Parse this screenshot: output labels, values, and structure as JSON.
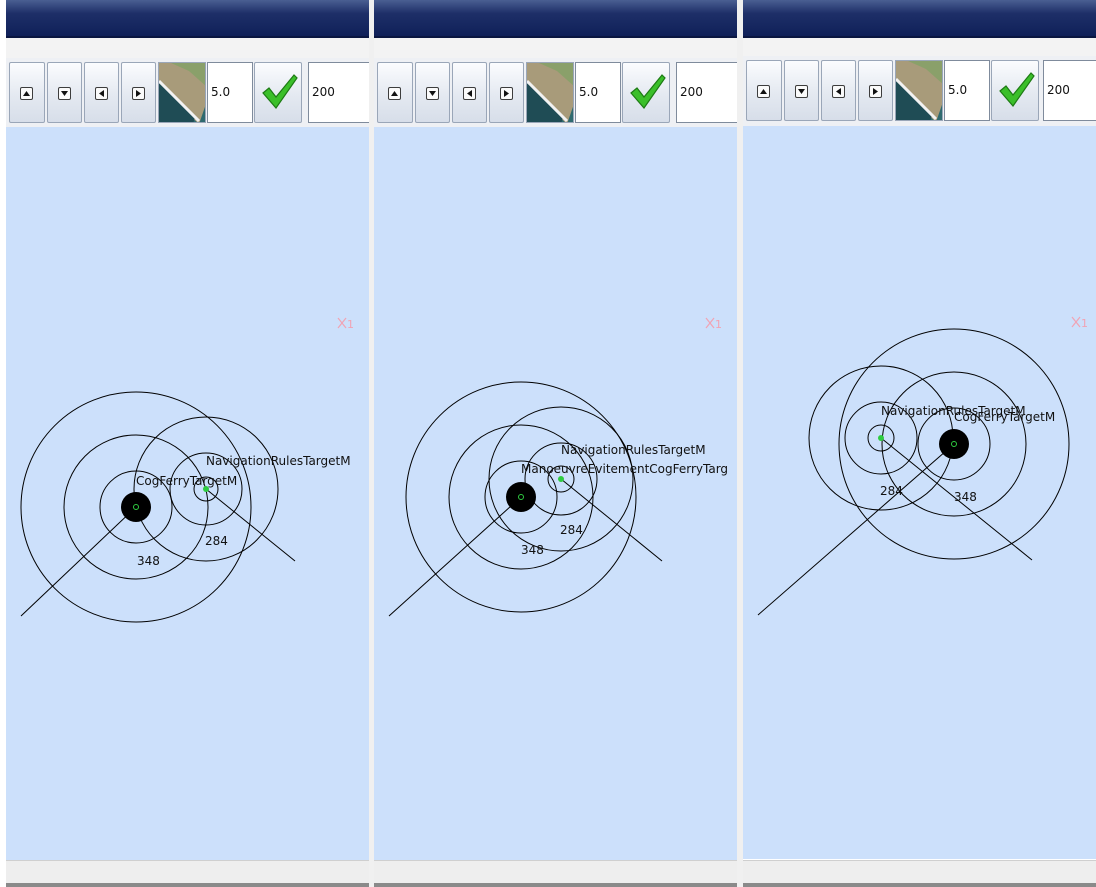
{
  "window": {
    "colors": {
      "titlebar": "#0e1f57",
      "map_background": "#cce0fb",
      "circle_stroke": "#000000",
      "own_ship": "#000000",
      "target_dot": "#2ecc40",
      "marker": "#f1a3b4"
    }
  },
  "toolbar": {
    "up_icon": "arrow-up-icon",
    "down_icon": "arrow-down-icon",
    "left_icon": "arrow-left-icon",
    "right_icon": "arrow-right-icon",
    "map_thumbnail_icon": "satellite-map-thumbnail-icon",
    "scale_value": "5.0",
    "apply_icon": "green-checkmark-icon",
    "range_value": "200"
  },
  "panels": [
    {
      "marker_label": "1",
      "labels": {
        "own": "CogFerryTargetM",
        "target": "NavigationRulesTargetM",
        "own_range": "348",
        "target_range": "284"
      }
    },
    {
      "marker_label": "1",
      "labels": {
        "own": "ManoeuvreEvitementCogFerryTarg",
        "target": "NavigationRulesTargetM",
        "own_range": "348",
        "target_range": "284"
      }
    },
    {
      "marker_label": "1",
      "labels": {
        "own": "CogFerryTargetM",
        "target": "NavigationRulesTargetM",
        "own_range": "348",
        "target_range": "284"
      }
    }
  ]
}
